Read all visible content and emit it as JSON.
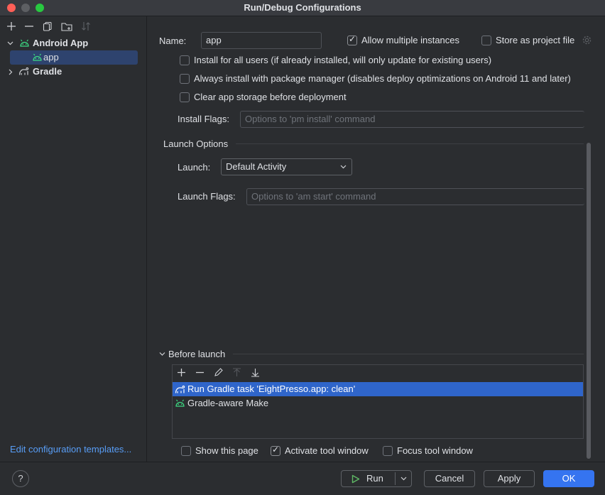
{
  "window": {
    "title": "Run/Debug Configurations"
  },
  "colors": {
    "accent": "#3574f0",
    "selection": "#2f65ca",
    "tree_selection": "#2e436e",
    "android": "#3ddc84",
    "link": "#589df6",
    "traffic_red": "#ff5f57"
  },
  "left_toolbar": [
    "add-icon",
    "remove-icon",
    "copy-icon",
    "new-folder-icon",
    "sort-icon"
  ],
  "tree": {
    "android_app": "Android App",
    "app": "app",
    "gradle": "Gradle"
  },
  "edit_templates": "Edit configuration templates...",
  "name": {
    "label": "Name:",
    "value": "app",
    "allow_multiple": "Allow multiple instances",
    "store_as_project": "Store as project file"
  },
  "install": {
    "all_users": "Install for all users (if already installed, will only update for existing users)",
    "package_manager": "Always install with package manager (disables deploy optimizations on Android 11 and later)",
    "clear_storage": "Clear app storage before deployment",
    "flags_label": "Install Flags:",
    "flags_placeholder": "Options to 'pm install' command"
  },
  "launch_options": {
    "section": "Launch Options",
    "launch_label": "Launch:",
    "launch_value": "Default Activity",
    "flags_label": "Launch Flags:",
    "flags_placeholder": "Options to 'am start' command"
  },
  "before_launch": {
    "section": "Before launch",
    "items": [
      "Run Gradle task 'EightPresso.app: clean'",
      "Gradle-aware Make"
    ]
  },
  "options": {
    "show_page": "Show this page",
    "activate_tool": "Activate tool window",
    "focus_tool": "Focus tool window"
  },
  "buttons": {
    "run": "Run",
    "cancel": "Cancel",
    "apply": "Apply",
    "ok": "OK",
    "help": "?"
  }
}
